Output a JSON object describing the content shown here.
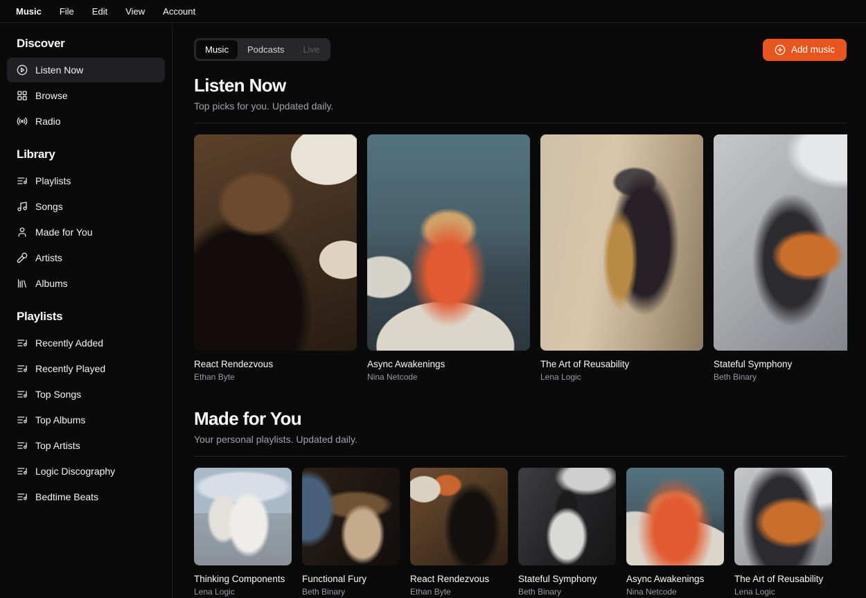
{
  "colors": {
    "background": "#0a0a0b",
    "accent_orange": "#e8551c",
    "surface": "#27272a",
    "border": "#1e1e22",
    "text_primary": "#fafafa",
    "text_muted": "#a1a1aa"
  },
  "menu_bar": {
    "items": [
      {
        "label": "Music",
        "bold": true
      },
      {
        "label": "File"
      },
      {
        "label": "Edit"
      },
      {
        "label": "View"
      },
      {
        "label": "Account"
      }
    ]
  },
  "sidebar": {
    "sections": [
      {
        "title": "Discover",
        "items": [
          {
            "label": "Listen Now",
            "icon": "circle-play-icon",
            "active": true
          },
          {
            "label": "Browse",
            "icon": "layout-grid-icon",
            "active": false
          },
          {
            "label": "Radio",
            "icon": "radio-icon",
            "active": false
          }
        ]
      },
      {
        "title": "Library",
        "items": [
          {
            "label": "Playlists",
            "icon": "list-music-icon",
            "active": false
          },
          {
            "label": "Songs",
            "icon": "music-note-icon",
            "active": false
          },
          {
            "label": "Made for You",
            "icon": "user-icon",
            "active": false
          },
          {
            "label": "Artists",
            "icon": "mic-icon",
            "active": false
          },
          {
            "label": "Albums",
            "icon": "library-icon",
            "active": false
          }
        ]
      },
      {
        "title": "Playlists",
        "items": [
          {
            "label": "Recently Added",
            "icon": "list-music-icon",
            "active": false
          },
          {
            "label": "Recently Played",
            "icon": "list-music-icon",
            "active": false
          },
          {
            "label": "Top Songs",
            "icon": "list-music-icon",
            "active": false
          },
          {
            "label": "Top Albums",
            "icon": "list-music-icon",
            "active": false
          },
          {
            "label": "Top Artists",
            "icon": "list-music-icon",
            "active": false
          },
          {
            "label": "Logic Discography",
            "icon": "list-music-icon",
            "active": false
          },
          {
            "label": "Bedtime Beats",
            "icon": "list-music-icon",
            "active": false
          }
        ]
      }
    ]
  },
  "main": {
    "tabs": [
      {
        "label": "Music",
        "state": "active"
      },
      {
        "label": "Podcasts",
        "state": "normal"
      },
      {
        "label": "Live",
        "state": "disabled"
      }
    ],
    "add_music_label": "Add music",
    "sections": [
      {
        "title": "Listen Now",
        "subtitle": "Top picks for you. Updated daily.",
        "albums": [
          {
            "title": "React Rendezvous",
            "artist": "Ethan Byte",
            "art": "woman-headphones-bookshelf"
          },
          {
            "title": "Async Awakenings",
            "artist": "Nina Netcode",
            "art": "blonde-woman-window"
          },
          {
            "title": "The Art of Reusability",
            "artist": "Lena Logic",
            "art": "saxophone-street-player"
          },
          {
            "title": "Stateful Symphony",
            "artist": "Beth Binary",
            "art": "street-guitarist"
          }
        ]
      },
      {
        "title": "Made for You",
        "subtitle": "Your personal playlists. Updated daily.",
        "albums": [
          {
            "title": "Thinking Components",
            "artist": "Lena Logic",
            "art": "two-people-crouching-white"
          },
          {
            "title": "Functional Fury",
            "artist": "Beth Binary",
            "art": "pianist-dark-room"
          },
          {
            "title": "React Rendezvous",
            "artist": "Ethan Byte",
            "art": "woman-headphones-bookshelf-side"
          },
          {
            "title": "Stateful Symphony",
            "artist": "Beth Binary",
            "art": "bw-person-chair"
          },
          {
            "title": "Async Awakenings",
            "artist": "Nina Netcode",
            "art": "blonde-woman-window"
          },
          {
            "title": "The Art of Reusability",
            "artist": "Lena Logic",
            "art": "street-guitarist"
          }
        ]
      }
    ]
  }
}
